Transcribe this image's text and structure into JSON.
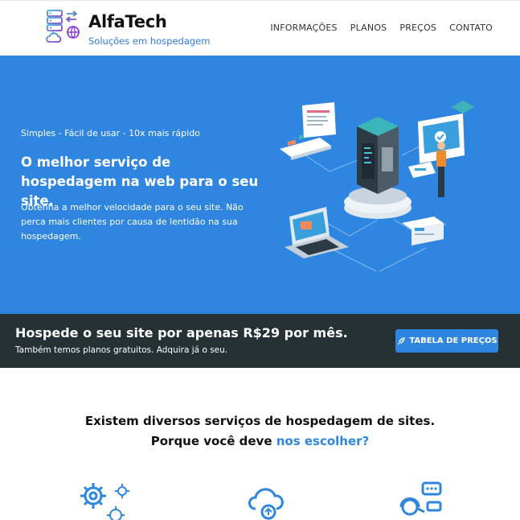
{
  "header": {
    "brand_name": "AlfaTech",
    "brand_tagline": "Soluções em hospedagem",
    "logo_icon": "server-cloud-logo-icon",
    "nav": [
      "INFORMAÇÕES",
      "PLANOS",
      "PREÇOS",
      "CONTATO"
    ]
  },
  "hero": {
    "kicker": "Simples - Fácil de usar - 10x mais rápido",
    "title": "O melhor serviço de hospedagem na web para o seu site.",
    "text": "Obtenha a melhor velocidade para o seu site. Não perca mais clientes por causa de lentidão na sua hospedagem.",
    "illustration": "hosting-isometric-illustration"
  },
  "cta": {
    "title": "Hospede o seu site por apenas R$29 por mês.",
    "subtitle": "Também temos planos gratuitos. Adquira já o seu.",
    "button_label": "TABELA DE PREÇOS",
    "button_icon": "rocket-icon"
  },
  "features": {
    "title_line1": "Existem diversos serviços de hospedagem de sites.",
    "title_line2_prefix": "Porque você deve ",
    "title_line2_accent": "nos escolher?",
    "icons": [
      "gears-icon",
      "cloud-upload-icon",
      "support-agent-icon"
    ]
  },
  "colors": {
    "primary": "#2f86e0",
    "dark_bar": "#263136",
    "text": "#111111"
  }
}
